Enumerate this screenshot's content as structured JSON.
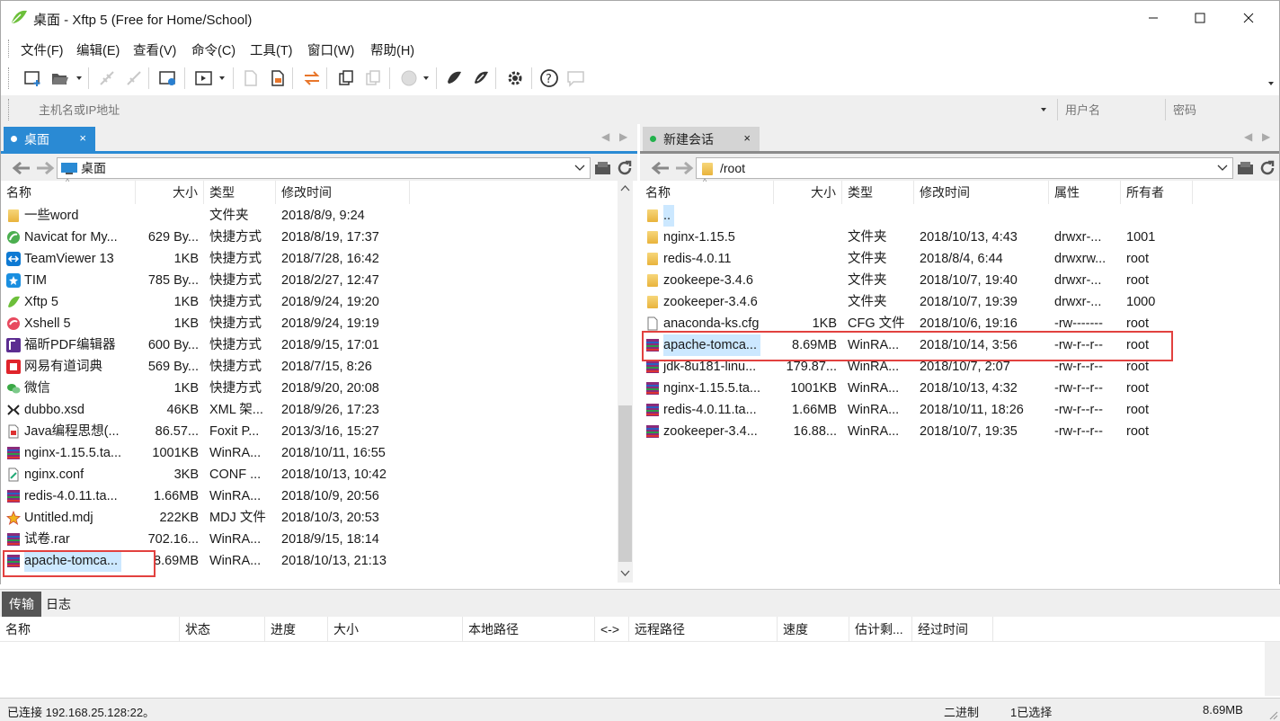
{
  "window": {
    "title": "桌面 - Xftp 5 (Free for Home/School)"
  },
  "menu": [
    "文件(F)",
    "编辑(E)",
    "查看(V)",
    "命令(C)",
    "工具(T)",
    "窗口(W)",
    "帮助(H)"
  ],
  "address": {
    "host_placeholder": "主机名或IP地址",
    "user_placeholder": "用户名",
    "pass_placeholder": "密码"
  },
  "local": {
    "tab": "桌面",
    "path": "桌面",
    "columns": [
      "名称",
      "大小",
      "类型",
      "修改时间"
    ],
    "files": [
      {
        "name": "一些word",
        "size": "",
        "type": "文件夹",
        "time": "2018/8/9, 9:24",
        "icon": "folder"
      },
      {
        "name": "Navicat for My...",
        "size": "629 By...",
        "type": "快捷方式",
        "time": "2018/8/19, 17:37",
        "icon": "navicat"
      },
      {
        "name": "TeamViewer 13",
        "size": "1KB",
        "type": "快捷方式",
        "time": "2018/7/28, 16:42",
        "icon": "teamviewer"
      },
      {
        "name": "TIM",
        "size": "785 By...",
        "type": "快捷方式",
        "time": "2018/2/27, 12:47",
        "icon": "tim"
      },
      {
        "name": "Xftp 5",
        "size": "1KB",
        "type": "快捷方式",
        "time": "2018/9/24, 19:20",
        "icon": "xftp"
      },
      {
        "name": "Xshell 5",
        "size": "1KB",
        "type": "快捷方式",
        "time": "2018/9/24, 19:19",
        "icon": "xshell"
      },
      {
        "name": "福昕PDF编辑器",
        "size": "600 By...",
        "type": "快捷方式",
        "time": "2018/9/15, 17:01",
        "icon": "pdf"
      },
      {
        "name": "网易有道词典",
        "size": "569 By...",
        "type": "快捷方式",
        "time": "2018/7/15, 8:26",
        "icon": "youdao"
      },
      {
        "name": "微信",
        "size": "1KB",
        "type": "快捷方式",
        "time": "2018/9/20, 20:08",
        "icon": "wechat"
      },
      {
        "name": "dubbo.xsd",
        "size": "46KB",
        "type": "XML 架...",
        "time": "2018/9/26, 17:23",
        "icon": "xml"
      },
      {
        "name": "Java编程思想(...",
        "size": "86.57...",
        "type": "Foxit P...",
        "time": "2013/3/16, 15:27",
        "icon": "pdfdoc"
      },
      {
        "name": "nginx-1.15.5.ta...",
        "size": "1001KB",
        "type": "WinRA...",
        "time": "2018/10/11, 16:55",
        "icon": "rar"
      },
      {
        "name": "nginx.conf",
        "size": "3KB",
        "type": "CONF ...",
        "time": "2018/10/13, 10:42",
        "icon": "conf"
      },
      {
        "name": "redis-4.0.11.ta...",
        "size": "1.66MB",
        "type": "WinRA...",
        "time": "2018/10/9, 20:56",
        "icon": "rar"
      },
      {
        "name": "Untitled.mdj",
        "size": "222KB",
        "type": "MDJ 文件",
        "time": "2018/10/3, 20:53",
        "icon": "mdj"
      },
      {
        "name": "试卷.rar",
        "size": "702.16...",
        "type": "WinRA...",
        "time": "2018/9/15, 18:14",
        "icon": "rar"
      },
      {
        "name": "apache-tomca...",
        "size": "8.69MB",
        "type": "WinRA...",
        "time": "2018/10/13, 21:13",
        "icon": "rar"
      }
    ]
  },
  "remote": {
    "tab": "新建会话",
    "path": "/root",
    "columns": [
      "名称",
      "大小",
      "类型",
      "修改时间",
      "属性",
      "所有者"
    ],
    "files": [
      {
        "name": "..",
        "size": "",
        "type": "",
        "time": "",
        "attr": "",
        "owner": "",
        "icon": "folder"
      },
      {
        "name": "nginx-1.15.5",
        "size": "",
        "type": "文件夹",
        "time": "2018/10/13, 4:43",
        "attr": "drwxr-...",
        "owner": "1001",
        "icon": "folder"
      },
      {
        "name": "redis-4.0.11",
        "size": "",
        "type": "文件夹",
        "time": "2018/8/4, 6:44",
        "attr": "drwxrw...",
        "owner": "root",
        "icon": "folder"
      },
      {
        "name": "zookeepe-3.4.6",
        "size": "",
        "type": "文件夹",
        "time": "2018/10/7, 19:40",
        "attr": "drwxr-...",
        "owner": "root",
        "icon": "folder"
      },
      {
        "name": "zookeeper-3.4.6",
        "size": "",
        "type": "文件夹",
        "time": "2018/10/7, 19:39",
        "attr": "drwxr-...",
        "owner": "1000",
        "icon": "folder"
      },
      {
        "name": "anaconda-ks.cfg",
        "size": "1KB",
        "type": "CFG 文件",
        "time": "2018/10/6, 19:16",
        "attr": "-rw-------",
        "owner": "root",
        "icon": "file"
      },
      {
        "name": "apache-tomca...",
        "size": "8.69MB",
        "type": "WinRA...",
        "time": "2018/10/14, 3:56",
        "attr": "-rw-r--r--",
        "owner": "root",
        "icon": "rar"
      },
      {
        "name": "jdk-8u181-linu...",
        "size": "179.87...",
        "type": "WinRA...",
        "time": "2018/10/7, 2:07",
        "attr": "-rw-r--r--",
        "owner": "root",
        "icon": "rar"
      },
      {
        "name": "nginx-1.15.5.ta...",
        "size": "1001KB",
        "type": "WinRA...",
        "time": "2018/10/13, 4:32",
        "attr": "-rw-r--r--",
        "owner": "root",
        "icon": "rar"
      },
      {
        "name": "redis-4.0.11.ta...",
        "size": "1.66MB",
        "type": "WinRA...",
        "time": "2018/10/11, 18:26",
        "attr": "-rw-r--r--",
        "owner": "root",
        "icon": "rar"
      },
      {
        "name": "zookeeper-3.4...",
        "size": "16.88...",
        "type": "WinRA...",
        "time": "2018/10/7, 19:35",
        "attr": "-rw-r--r--",
        "owner": "root",
        "icon": "rar"
      }
    ]
  },
  "transfer": {
    "tabs": [
      "传输",
      "日志"
    ],
    "columns": [
      "名称",
      "状态",
      "进度",
      "大小",
      "本地路径",
      "<->",
      "远程路径",
      "速度",
      "估计剩...",
      "经过时间"
    ]
  },
  "status": {
    "connection": "已连接 192.168.25.128:22。",
    "mode": "二进制",
    "selection": "1已选择",
    "size": "8.69MB"
  },
  "colors": {
    "accent": "#2a8ad4",
    "highlight": "#e2413f",
    "selected": "#cce8ff"
  }
}
